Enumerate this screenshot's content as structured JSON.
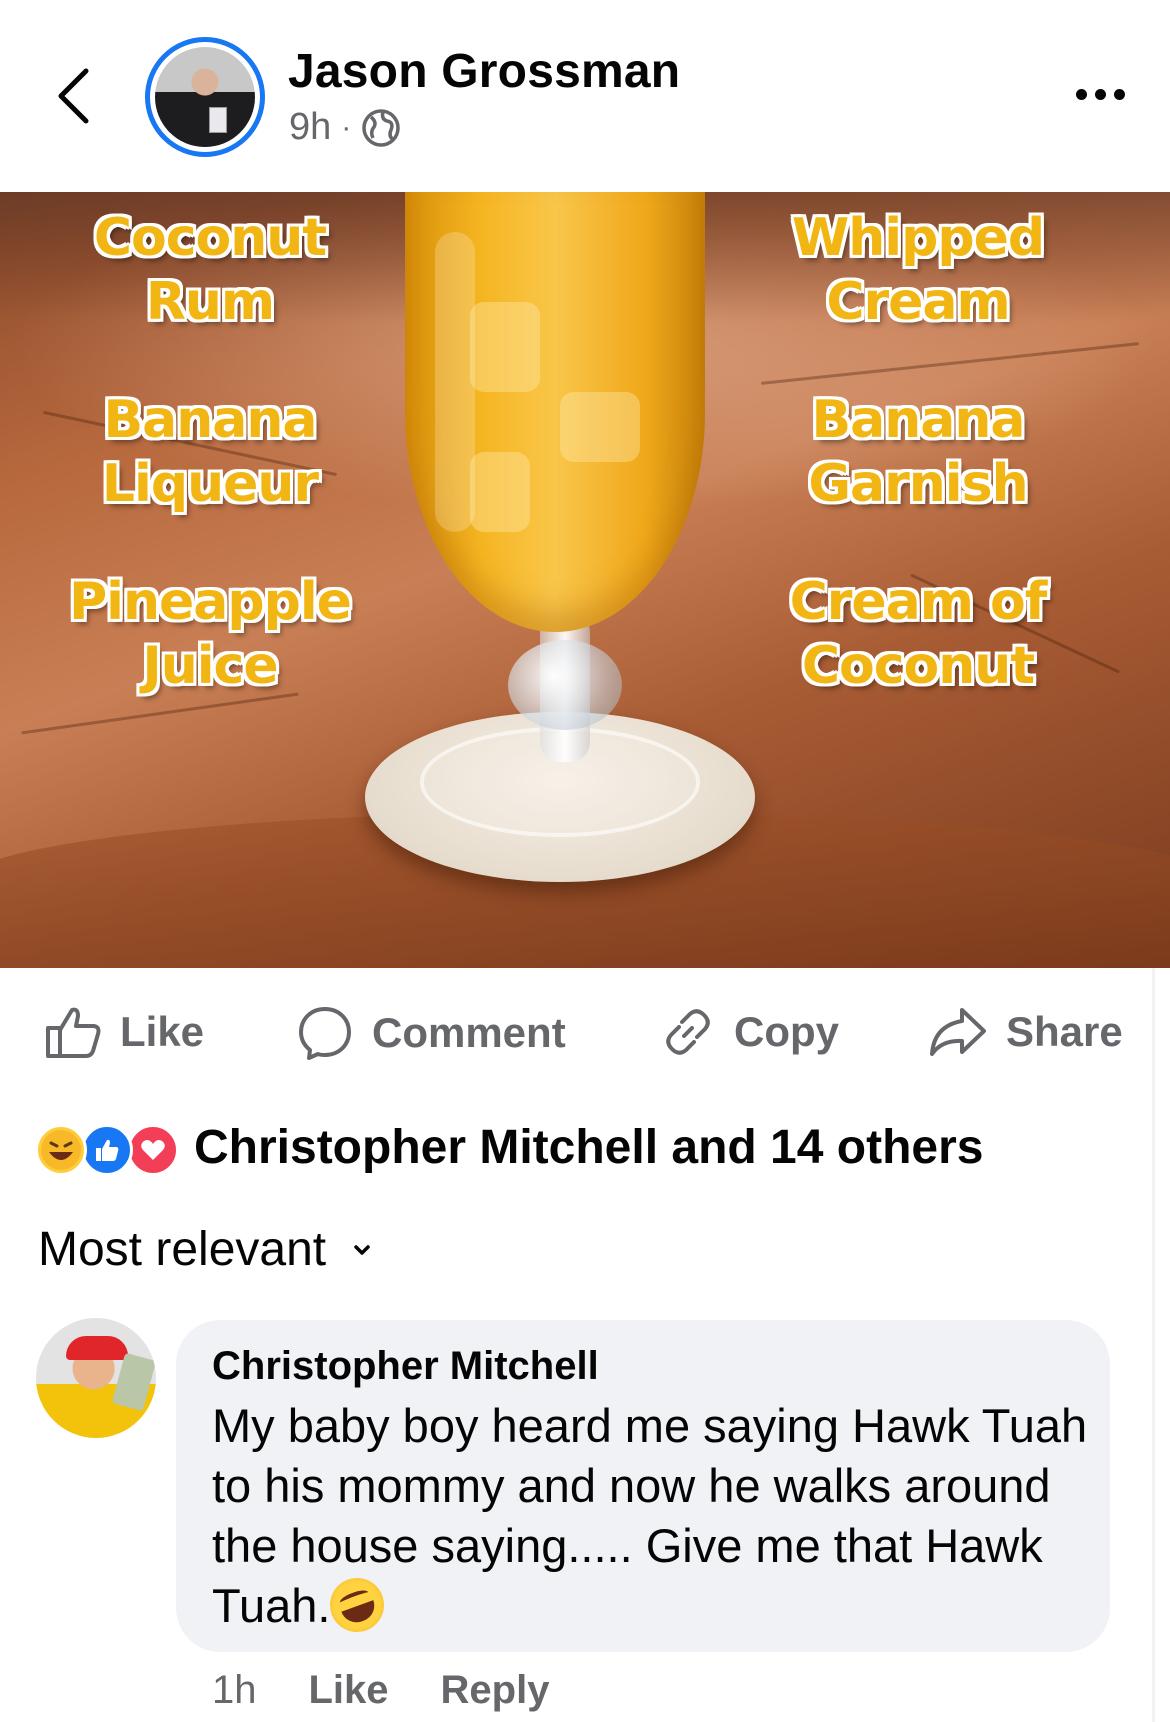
{
  "post": {
    "author": "Jason Grossman",
    "time": "9h",
    "separator": "·",
    "audience_icon": "globe-icon"
  },
  "image": {
    "ingredients_left": [
      "Coconut Rum",
      "Banana Liqueur",
      "Pineapple Juice"
    ],
    "ingredients_right": [
      "Whipped Cream",
      "Banana Garnish",
      "Cream of Coconut"
    ]
  },
  "actions": {
    "like": "Like",
    "comment": "Comment",
    "copy": "Copy",
    "share": "Share"
  },
  "reactions": {
    "types": [
      "haha",
      "like",
      "love"
    ],
    "summary": "Christopher Mitchell and 14 others"
  },
  "sort": {
    "label": "Most relevant"
  },
  "comment": {
    "author": "Christopher Mitchell",
    "text": "My baby boy heard me saying Hawk Tuah to his mommy and now he walks around the house saying..... Give me that Hawk Tuah.",
    "emoji": "rolling-on-floor-laughing",
    "time": "1h",
    "like": "Like",
    "reply": "Reply"
  },
  "colors": {
    "accent": "#1877f2",
    "secondary_text": "#65676b",
    "bubble": "#f0f2f5",
    "ingredient_text": "#f2b614"
  }
}
